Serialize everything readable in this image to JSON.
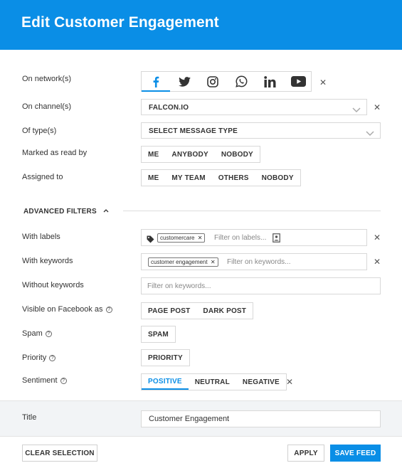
{
  "header": {
    "title": "Edit Customer Engagement"
  },
  "labels": {
    "networks": "On network(s)",
    "channels": "On channel(s)",
    "types": "Of type(s)",
    "marked_read": "Marked as read by",
    "assigned": "Assigned to",
    "with_labels": "With labels",
    "with_keywords": "With keywords",
    "without_keywords": "Without keywords",
    "visible_fb": "Visible on Facebook as",
    "spam": "Spam",
    "priority": "Priority",
    "sentiment": "Sentiment",
    "title": "Title"
  },
  "networks": {
    "items": [
      "facebook-icon",
      "twitter-icon",
      "instagram-icon",
      "whatsapp-icon",
      "linkedin-icon",
      "youtube-icon"
    ],
    "selected": "facebook-icon",
    "accent": "#0a8ee6"
  },
  "channel": {
    "value": "FALCON.IO"
  },
  "type": {
    "value": "SELECT MESSAGE TYPE"
  },
  "marked_read": {
    "options": [
      "ME",
      "ANYBODY",
      "NOBODY"
    ]
  },
  "assigned": {
    "options": [
      "ME",
      "MY TEAM",
      "OTHERS",
      "NOBODY"
    ]
  },
  "advanced": {
    "title": "ADVANCED FILTERS",
    "state": "expanded"
  },
  "with_labels": {
    "tag": "customercare",
    "placeholder": "Filter on labels..."
  },
  "with_keywords": {
    "tag": "customer engagement",
    "placeholder": "Filter on keywords..."
  },
  "without_keywords": {
    "placeholder": "Filter on keywords..."
  },
  "visible_fb": {
    "options": [
      "PAGE POST",
      "DARK POST"
    ]
  },
  "spam": {
    "option": "SPAM"
  },
  "priority": {
    "option": "PRIORITY"
  },
  "sentiment": {
    "options": [
      "POSITIVE",
      "NEUTRAL",
      "NEGATIVE"
    ],
    "selected": "POSITIVE"
  },
  "title_field": {
    "value": "Customer Engagement"
  },
  "footer": {
    "clear": "CLEAR SELECTION",
    "apply": "APPLY",
    "save": "SAVE FEED"
  },
  "colors": {
    "brand": "#0a8ee6"
  }
}
